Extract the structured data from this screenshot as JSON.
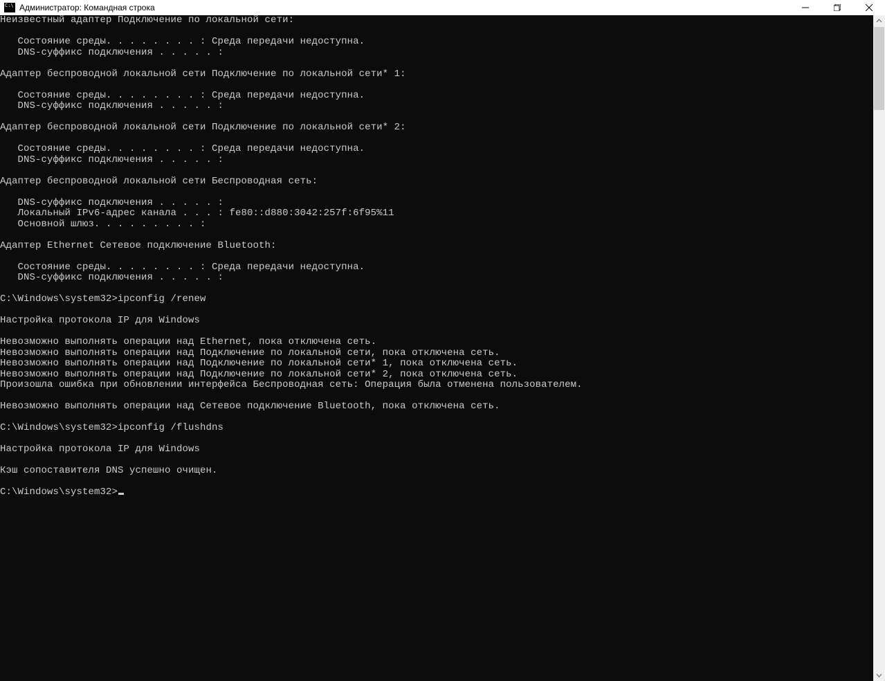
{
  "titlebar": {
    "title": "Администратор: Командная строка"
  },
  "terminal": {
    "lines": [
      "Неизвестный адаптер Подключение по локальной сети:",
      "",
      "   Состояние среды. . . . . . . . : Среда передачи недоступна.",
      "   DNS-суффикс подключения . . . . . :",
      "",
      "Адаптер беспроводной локальной сети Подключение по локальной сети* 1:",
      "",
      "   Состояние среды. . . . . . . . : Среда передачи недоступна.",
      "   DNS-суффикс подключения . . . . . :",
      "",
      "Адаптер беспроводной локальной сети Подключение по локальной сети* 2:",
      "",
      "   Состояние среды. . . . . . . . : Среда передачи недоступна.",
      "   DNS-суффикс подключения . . . . . :",
      "",
      "Адаптер беспроводной локальной сети Беспроводная сеть:",
      "",
      "   DNS-суффикс подключения . . . . . :",
      "   Локальный IPv6-адрес канала . . . : fe80::d880:3042:257f:6f95%11",
      "   Основной шлюз. . . . . . . . . :",
      "",
      "Адаптер Ethernet Сетевое подключение Bluetooth:",
      "",
      "   Состояние среды. . . . . . . . : Среда передачи недоступна.",
      "   DNS-суффикс подключения . . . . . :",
      "",
      "C:\\Windows\\system32>ipconfig /renew",
      "",
      "Настройка протокола IP для Windows",
      "",
      "Невозможно выполнять операции над Ethernet, пока отключена сеть.",
      "Невозможно выполнять операции над Подключение по локальной сети, пока отключена сеть.",
      "Невозможно выполнять операции над Подключение по локальной сети* 1, пока отключена сеть.",
      "Невозможно выполнять операции над Подключение по локальной сети* 2, пока отключена сеть.",
      "Произошла ошибка при обновлении интерфейса Беспроводная сеть: Операция была отменена пользователем.",
      "",
      "Невозможно выполнять операции над Сетевое подключение Bluetooth, пока отключена сеть.",
      "",
      "C:\\Windows\\system32>ipconfig /flushdns",
      "",
      "Настройка протокола IP для Windows",
      "",
      "Кэш сопоставителя DNS успешно очищен.",
      "",
      "C:\\Windows\\system32>"
    ],
    "prompt_has_cursor": true
  }
}
